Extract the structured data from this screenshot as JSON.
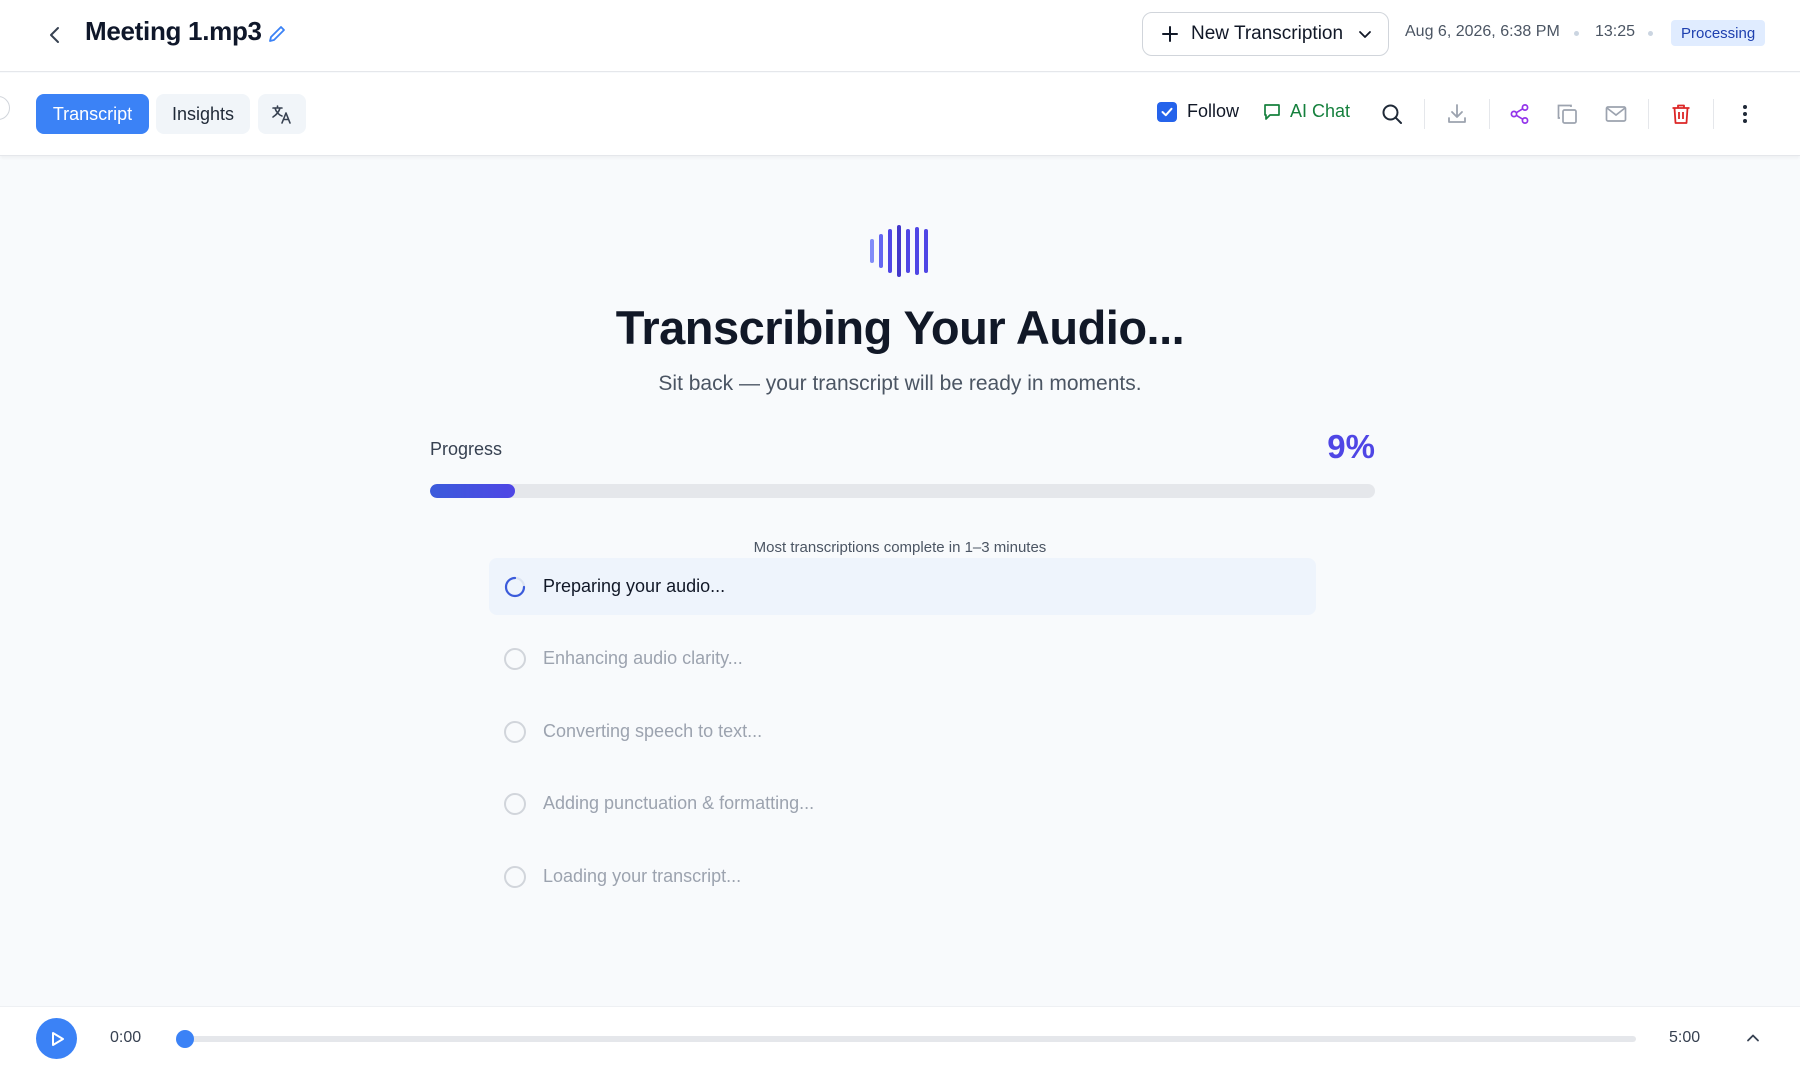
{
  "header": {
    "file_name": "Meeting 1.mp3",
    "new_transcription_label": "New Transcription",
    "date": "Aug 6, 2026, 6:38 PM",
    "duration": "13:25",
    "status": "Processing",
    "status_color": "#1e40af"
  },
  "toolbar": {
    "tabs": [
      {
        "label": "Transcript",
        "active": true
      },
      {
        "label": "Insights",
        "active": false
      }
    ],
    "follow_label": "Follow",
    "follow_checked": true,
    "ai_chat_label": "AI Chat",
    "icons": [
      "search-icon",
      "download-icon",
      "share-icon",
      "copy-icon",
      "mail-icon",
      "trash-icon",
      "more-vertical-icon"
    ]
  },
  "main": {
    "title": "Transcribing Your Audio...",
    "subtitle": "Sit back — your transcript will be ready in moments.",
    "progress_label": "Progress",
    "progress_percent_text": "9%",
    "progress_value": 0.09,
    "eta_text": "Most transcriptions complete in 1–3 minutes",
    "steps": [
      {
        "label": "Preparing your audio...",
        "state": "active"
      },
      {
        "label": "Enhancing audio clarity...",
        "state": "pending"
      },
      {
        "label": "Converting speech to text...",
        "state": "pending"
      },
      {
        "label": "Adding punctuation & formatting...",
        "state": "pending"
      },
      {
        "label": "Loading your transcript...",
        "state": "pending"
      }
    ]
  },
  "player": {
    "current_time": "0:00",
    "total_time": "5:00",
    "position": 0.0
  },
  "colors": {
    "accent": "#3b82f6",
    "progress": "#4f46e5",
    "ai_chat": "#15803d",
    "danger": "#dc2626",
    "share": "#9333ea"
  }
}
